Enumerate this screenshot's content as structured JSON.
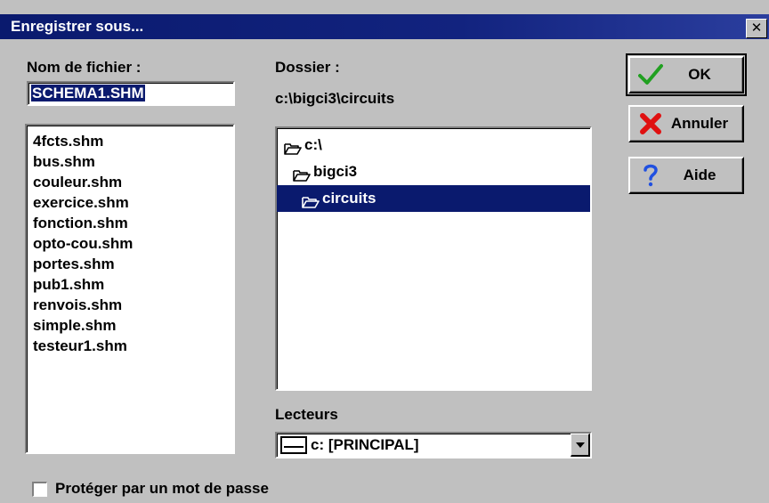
{
  "dialog": {
    "title": "Enregistrer sous...",
    "close_label": "✕"
  },
  "filename": {
    "label": "Nom de fichier :",
    "value": "SCHEMA1.SHM"
  },
  "files": [
    "4fcts.shm",
    "bus.shm",
    "couleur.shm",
    "exercice.shm",
    "fonction.shm",
    "opto-cou.shm",
    "portes.shm",
    "pub1.shm",
    "renvois.shm",
    "simple.shm",
    "testeur1.shm"
  ],
  "folder": {
    "label": "Dossier :",
    "path": "c:\\bigci3\\circuits",
    "tree": [
      {
        "name": "c:\\",
        "indent": 0,
        "icon": "open-folder-icon",
        "selected": false
      },
      {
        "name": "bigci3",
        "indent": 1,
        "icon": "open-folder-icon",
        "selected": false
      },
      {
        "name": "circuits",
        "indent": 2,
        "icon": "open-folder-icon",
        "selected": true
      }
    ]
  },
  "drives": {
    "label": "Lecteurs",
    "selected": "c: [PRINCIPAL]",
    "icon": "drive-icon"
  },
  "buttons": {
    "ok": {
      "label": "OK",
      "icon": "checkmark-icon",
      "color": "#21a021"
    },
    "cancel": {
      "label": "Annuler",
      "icon": "red-x-icon",
      "color": "#e01010"
    },
    "help": {
      "label": "Aide",
      "icon": "question-icon",
      "color": "#2050e0"
    }
  },
  "password": {
    "label": "Protéger par un mot de passe",
    "checked": false
  },
  "colors": {
    "titlebar": "#0a1a6e",
    "selection": "#0a1a6e",
    "face": "#c0c0c0"
  }
}
